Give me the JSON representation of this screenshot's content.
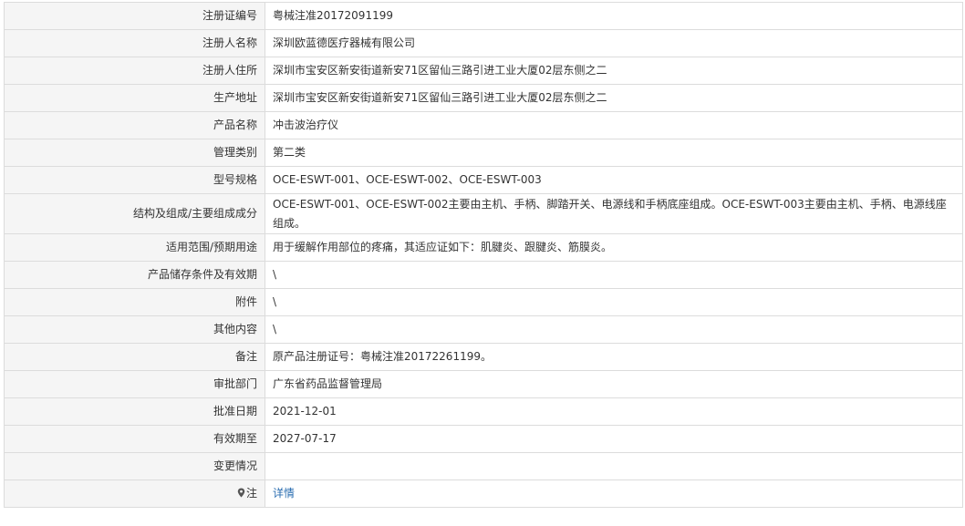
{
  "rows": [
    {
      "label": "注册证编号",
      "value": "粤械注准20172091199"
    },
    {
      "label": "注册人名称",
      "value": "深圳欧蓝德医疗器械有限公司"
    },
    {
      "label": "注册人住所",
      "value": "深圳市宝安区新安街道新安71区留仙三路引进工业大厦02层东侧之二"
    },
    {
      "label": "生产地址",
      "value": "深圳市宝安区新安街道新安71区留仙三路引进工业大厦02层东侧之二"
    },
    {
      "label": "产品名称",
      "value": "冲击波治疗仪"
    },
    {
      "label": "管理类别",
      "value": "第二类"
    },
    {
      "label": "型号规格",
      "value": "OCE-ESWT-001、OCE-ESWT-002、OCE-ESWT-003"
    },
    {
      "label": "结构及组成/主要组成成分",
      "value": "OCE-ESWT-001、OCE-ESWT-002主要由主机、手柄、脚踏开关、电源线和手柄底座组成。OCE-ESWT-003主要由主机、手柄、电源线座组成。"
    },
    {
      "label": "适用范围/预期用途",
      "value": "用于缓解作用部位的疼痛，其适应证如下：肌腱炎、跟腱炎、筋膜炎。"
    },
    {
      "label": "产品储存条件及有效期",
      "value": "\\"
    },
    {
      "label": "附件",
      "value": "\\"
    },
    {
      "label": "其他内容",
      "value": "\\"
    },
    {
      "label": "备注",
      "value": "原产品注册证号：粤械注准20172261199。"
    },
    {
      "label": "审批部门",
      "value": "广东省药品监督管理局"
    },
    {
      "label": "批准日期",
      "value": "2021-12-01"
    },
    {
      "label": "有效期至",
      "value": "2027-07-17"
    },
    {
      "label": "变更情况",
      "value": ""
    }
  ],
  "note": {
    "label": "注",
    "link_text": "详情",
    "icon": "map-pin-icon"
  }
}
